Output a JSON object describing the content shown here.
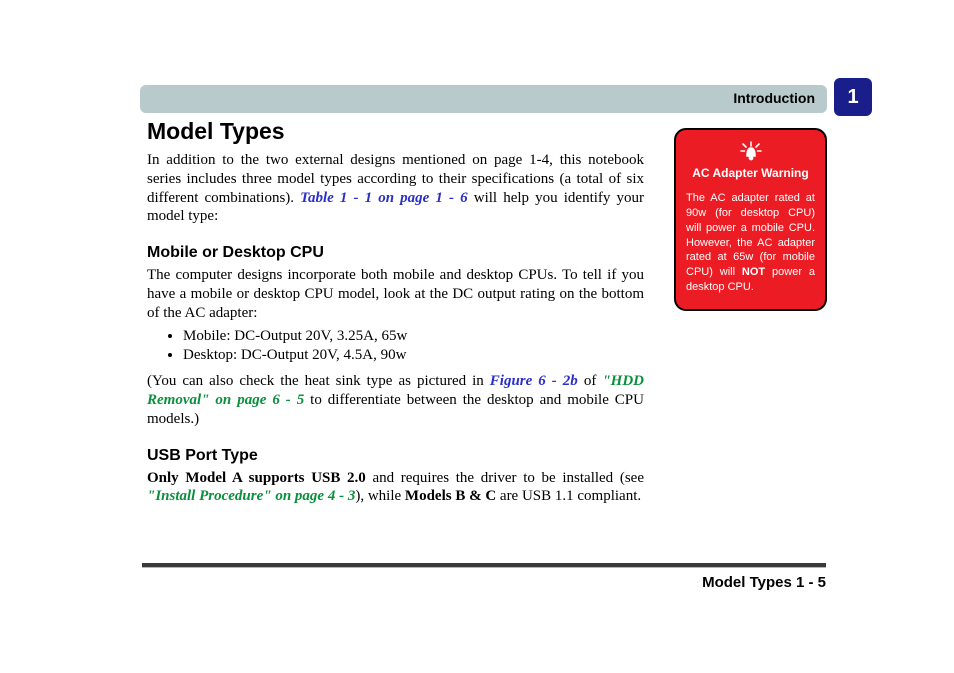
{
  "header": {
    "section": "Introduction",
    "chapter_number": "1"
  },
  "main": {
    "title": "Model Types",
    "intro_1": "In addition to the two external designs mentioned on page 1-4, this notebook series includes three model types according to their specifications (a total of six different combinations). ",
    "intro_xref": "Table 1 - 1 on page  1 - 6",
    "intro_2": " will help you identify your model type:",
    "sect1_heading": "Mobile or Desktop CPU",
    "sect1_para": "The computer designs incorporate both mobile and desktop CPUs. To tell if you have a mobile or desktop CPU model, look at the DC output rating on the bottom of the AC adapter:",
    "specs": [
      "Mobile: DC-Output 20V, 3.25A, 65w",
      "Desktop: DC-Output 20V, 4.5A, 90w"
    ],
    "sect1_note_1": "(You can also check the heat sink type as pictured in ",
    "sect1_note_xref1": "Figure 6 - 2b",
    "sect1_note_of": " of ",
    "sect1_note_xref2": "\"HDD Removal\" on page 6 - 5",
    "sect1_note_2": " to differentiate between the desktop and mobile CPU models.)",
    "sect2_heading": "USB Port Type",
    "sect2_bold1": "Only Model A supports USB 2.0",
    "sect2_mid": " and requires the driver to be installed (see ",
    "sect2_xref": "\"Install Procedure\" on page 4 - 3",
    "sect2_after": "), while ",
    "sect2_bold2": "Models B & C",
    "sect2_end": " are USB 1.1 compliant."
  },
  "warning": {
    "title": "AC Adapter Warning",
    "body_1": "The AC adapter rated at 90w (for desktop CPU) will power a mobile CPU. However, the AC adapter rated at 65w (for mobile CPU) will ",
    "body_not": "NOT",
    "body_2": " power a desktop CPU."
  },
  "footer": {
    "text": "Model Types  1  -  5"
  }
}
